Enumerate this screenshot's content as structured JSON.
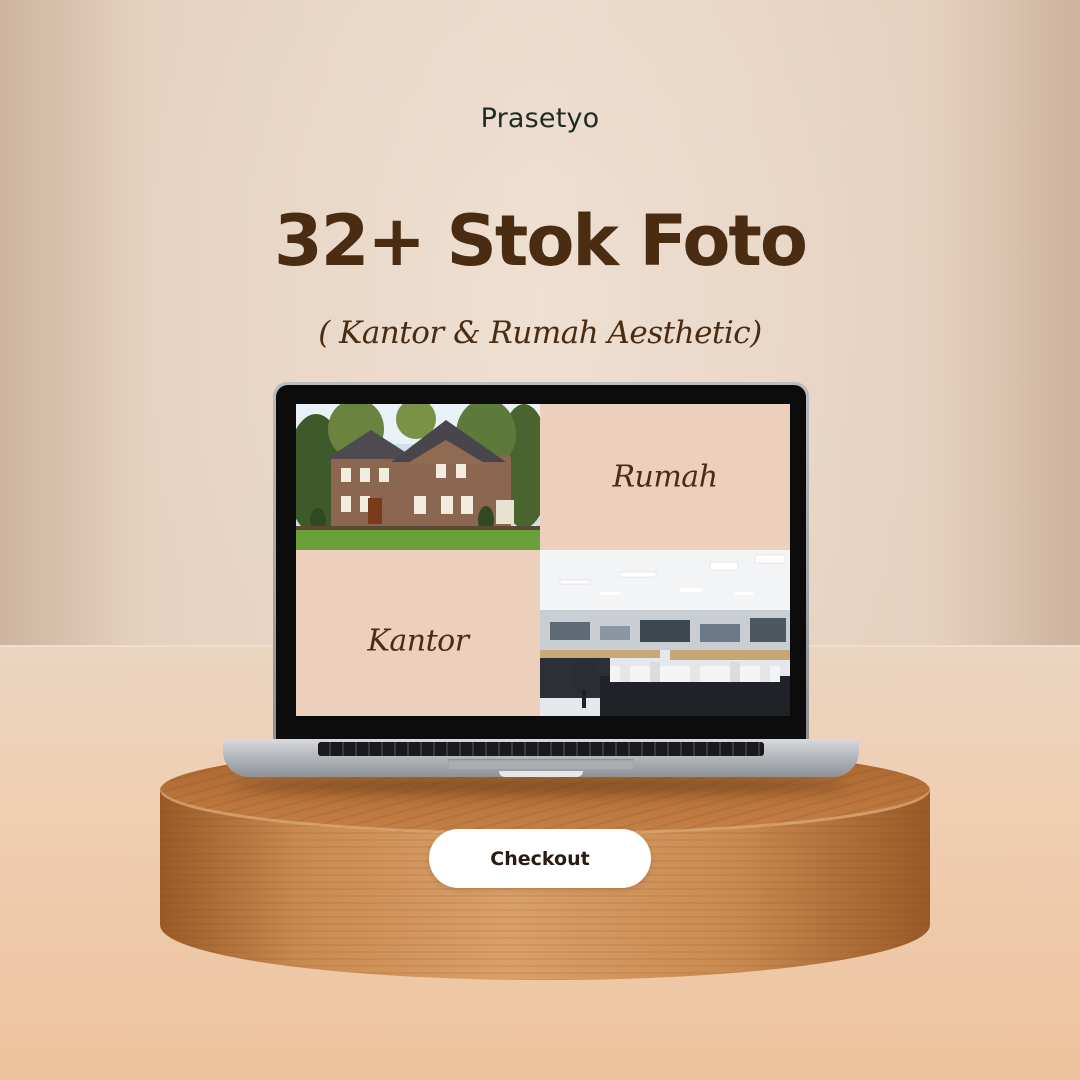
{
  "brand": "Prasetyo",
  "headline": "32+ Stok Foto",
  "subtitle": "( Kantor & Rumah Aesthetic)",
  "screen": {
    "label_rumah": "Rumah",
    "label_kantor": "Kantor"
  },
  "cta": {
    "label": "Checkout"
  },
  "colors": {
    "background": "#e6d2c0",
    "headline": "#4a2c12",
    "brand_text": "#1d2b23",
    "tile": "#ecd0bc",
    "button": "#ffffff"
  }
}
